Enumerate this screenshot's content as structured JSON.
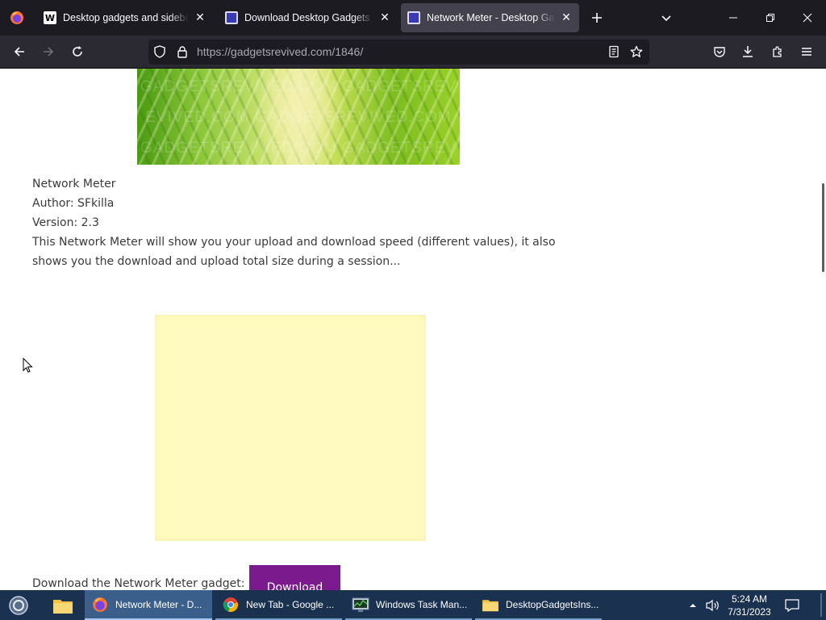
{
  "browser": {
    "tabs": [
      {
        "title": "Desktop gadgets and sidebar for Windows",
        "favicon": "W",
        "active": false
      },
      {
        "title": "Download Desktop Gadgets and Sidebar",
        "favicon": "gadgets-revived-favicon",
        "active": false
      },
      {
        "title": "Network Meter - Desktop Gadgets",
        "favicon": "gadgets-revived-favicon",
        "active": true
      }
    ],
    "url_host": "https://gadgetsrevived.com",
    "url_path": "/1846/",
    "theme": {
      "tabstrip": "#1c1b22",
      "navbar": "#2b2a33",
      "active_tab": "#42414d"
    }
  },
  "page": {
    "hero_watermarks": [
      "GADGETSREVIVED.COM  GADGETSREV",
      "EVIVED.COM  GADGETSREVIVED.COM",
      "GADGETSREVIVED.COM  GADGETSREV"
    ],
    "gadget_name": "Network Meter",
    "author": "Author: SFkilla",
    "version": "Version: 2.3",
    "description": "This Network Meter will show you your upload and download speed (different values), it also shows you the download and upload total size during a session...",
    "download_label": "Download the Network Meter gadget:",
    "download_button": "Download",
    "accent": "#7a1a8c"
  },
  "taskbar": {
    "items": [
      {
        "label": "Network Meter - D...",
        "icon": "firefox-icon",
        "state": "active"
      },
      {
        "label": "New Tab - Google ...",
        "icon": "chrome-icon",
        "state": "open"
      },
      {
        "label": "Windows Task Man...",
        "icon": "task-manager-icon",
        "state": "open"
      },
      {
        "label": "DesktopGadgetsIns...",
        "icon": "folder-icon",
        "state": "open"
      }
    ],
    "time": "5:24 AM",
    "date": "7/31/2023"
  }
}
